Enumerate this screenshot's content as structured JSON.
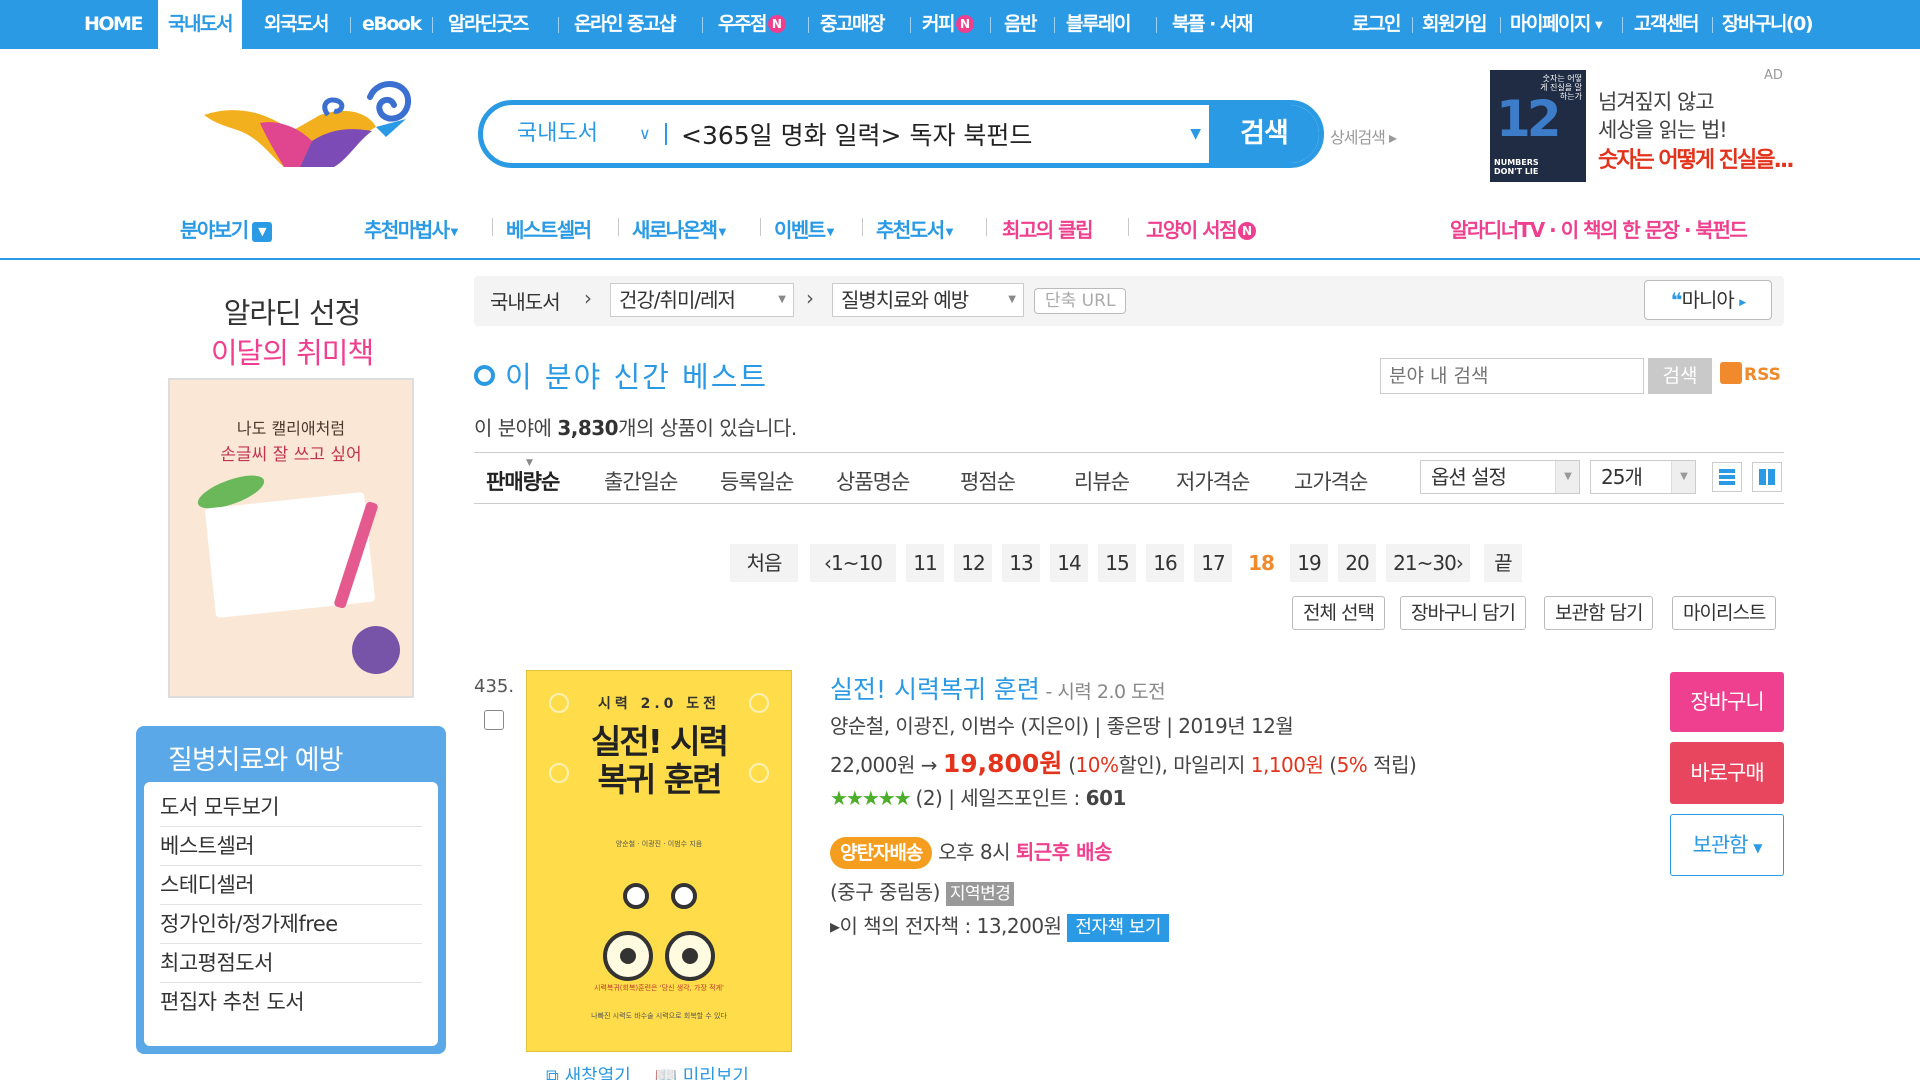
{
  "topnav": {
    "items": [
      "HOME",
      "국내도서",
      "외국도서",
      "eBook",
      "알라딘굿즈",
      "온라인 중고샵",
      "우주점",
      "중고매장",
      "커피",
      "음반",
      "블루레이",
      "북플 · 서재"
    ],
    "new_badge": "N",
    "right_items": [
      "로그인",
      "회원가입",
      "마이페이지",
      "고객센터",
      "장바구니(0)"
    ]
  },
  "search": {
    "category": "국내도서",
    "query": "<365일 명화 일력> 독자 북펀드",
    "button": "검색",
    "detail": "상세검색"
  },
  "ad": {
    "label": "AD",
    "line1": "넘겨짚지 않고",
    "line2": "세상을 읽는 법!",
    "line3": "숫자는 어떻게 진실을...",
    "cover_big": "12",
    "cover_text": "NUMBERS DON'T LIE",
    "cover_kor": "숫자는 어떻게 진실을 말하는가"
  },
  "subnav": {
    "items": [
      "분야보기",
      "추천마법사",
      "베스트셀러",
      "새로나온책",
      "이벤트",
      "추천도서",
      "최고의 클립",
      "고양이 서점"
    ],
    "right": "알라디너TV · 이 책의 한 문장 · 북펀드"
  },
  "promo": {
    "line1": "알라딘 선정",
    "line2": "이달의 취미책",
    "book_line1": "나도 캘리애처럼",
    "book_line2": "손글씨 잘 쓰고 싶어"
  },
  "leftmenu": {
    "title": "질병치료와 예방",
    "items": [
      "도서 모두보기",
      "베스트셀러",
      "스테디셀러",
      "정가인하/정가제free",
      "최고평점도서",
      "편집자 추천 도서"
    ]
  },
  "breadcrumb": {
    "home": "국내도서",
    "level1": "건강/취미/레저",
    "level2": "질병치료와 예방",
    "short_url": "단축 URL",
    "mania": "마니아"
  },
  "section": {
    "title": "이 분야 신간 베스트",
    "search_placeholder": "분야 내 검색",
    "search_button": "검색",
    "rss": "RSS",
    "count_prefix": "이 분야에 ",
    "count": "3,830",
    "count_suffix": "개의 상품이 있습니다."
  },
  "sort": {
    "options": [
      "판매량순",
      "출간일순",
      "등록일순",
      "상품명순",
      "평점순",
      "리뷰순",
      "저가격순",
      "고가격순"
    ],
    "option_setting": "옵션 설정",
    "page_size": "25개"
  },
  "pagination": {
    "first": "처음",
    "prev": "‹1~10",
    "pages": [
      "11",
      "12",
      "13",
      "14",
      "15",
      "16",
      "17",
      "18",
      "19",
      "20"
    ],
    "current": "18",
    "next": "21~30›",
    "last": "끝"
  },
  "actions": [
    "전체 선택",
    "장바구니 담기",
    "보관함 담기",
    "마이리스트"
  ],
  "product": {
    "rank": "435.",
    "title": "실전! 시력복귀 훈련",
    "subtitle": " - 시력 2.0 도전",
    "authors": "양순철, 이광진, 이범수 (지은이) | 좋은땅 | 2019년 12월",
    "list_price": "22,000원 → ",
    "sale_price": "19,800원",
    "discount_open": " (",
    "discount": "10%",
    "discount_close": "할인), 마일리지 ",
    "mileage": "1,100원",
    "mileage_rate_open": " (",
    "mileage_rate": "5%",
    "mileage_rate_close": " 적립)",
    "stars": "★★★★★",
    "review_count": " (2) | 세일즈포인트 : ",
    "sales_point": "601",
    "delivery_badge": "양탄자배송",
    "delivery_time": " 오후 8시 ",
    "delivery_type": "퇴근후 배송",
    "location": "(중구 중림동) ",
    "location_change": "지역변경",
    "ebook_text": "▸이 책의 전자책 : 13,200원 ",
    "ebook_button": "전자책 보기",
    "cover_top": "시력 2.0 도전",
    "cover_title": "실전! 시력복귀 훈련",
    "cover_small": "양순철 · 이광진 · 이범수 지음",
    "cover_red": "시력복귀(회복)훈련은 '당신 생각, 가장 적게'",
    "cover_bottom": "나빠진 시력도 바수술 시력으로 회복할 수 있다",
    "new_window": "새창열기",
    "preview": "미리보기",
    "btn_cart": "장바구니",
    "btn_buy": "바로구매",
    "btn_keep": "보관함"
  },
  "colors": {
    "brand_blue": "#2a9ae5",
    "pink": "#ef3f8f",
    "sale_red": "#e4331c",
    "orange": "#f59d1f"
  }
}
